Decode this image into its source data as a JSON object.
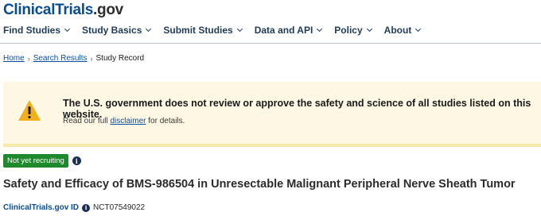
{
  "logo": {
    "part1": "ClinicalTrials",
    "part2": ".gov"
  },
  "nav": [
    {
      "label": "Find Studies"
    },
    {
      "label": "Study Basics"
    },
    {
      "label": "Submit Studies"
    },
    {
      "label": "Data and API"
    },
    {
      "label": "Policy"
    },
    {
      "label": "About"
    }
  ],
  "breadcrumb": {
    "home": "Home",
    "results": "Search Results",
    "current": "Study Record"
  },
  "alert": {
    "title": "The U.S. government does not review or approve the safety and science of all studies listed on this website.",
    "body_pre": "Read our full ",
    "body_link": "disclaimer",
    "body_post": " for details."
  },
  "status": {
    "label": "Not yet recruiting",
    "color": "#1f8a2d"
  },
  "study": {
    "title": "Safety and Efficacy of BMS-986504 in Unresectable Malignant Peripheral Nerve Sheath Tumor",
    "id_label": "ClinicalTrials.gov ID",
    "id_value": "NCT07549022"
  },
  "icons": {
    "warning": "warning-triangle-icon",
    "info": "info-icon"
  }
}
